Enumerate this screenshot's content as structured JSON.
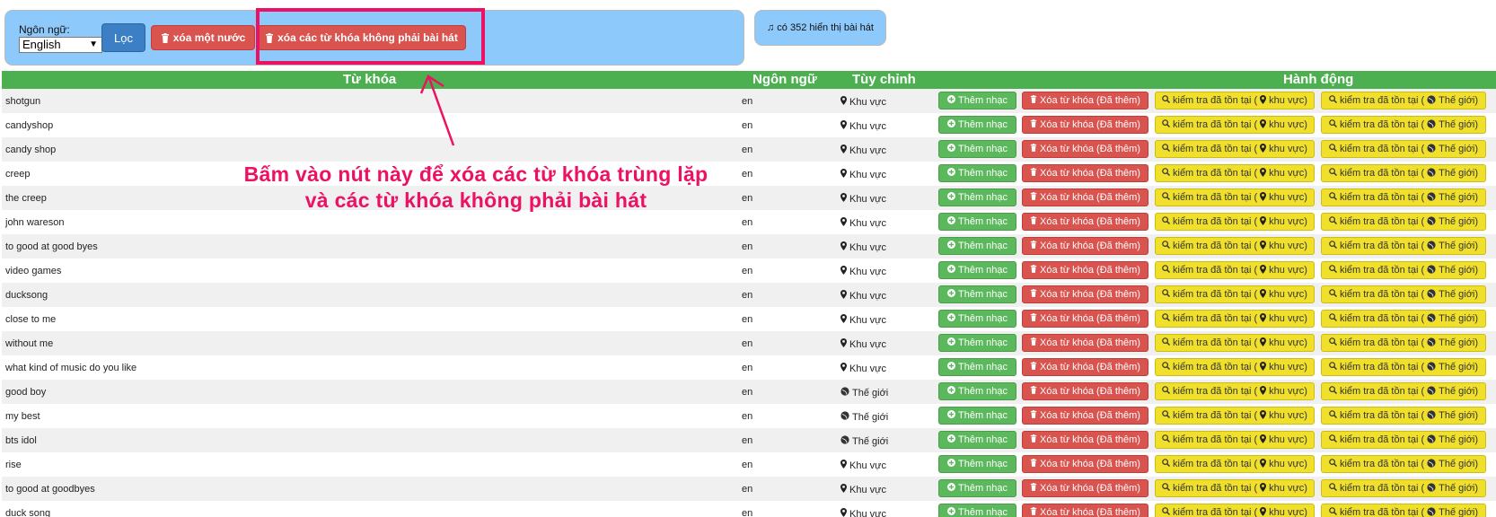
{
  "filter": {
    "language_label": "Ngôn ngữ:",
    "language_value": "English",
    "filter_button": "Lọc",
    "delete_one_button": "xóa một nước",
    "delete_non_song_button": "xóa các từ khóa không phải bài hát"
  },
  "count_badge": "có 352 hiển thị bài hát",
  "headers": {
    "keyword": "Từ khóa",
    "language": "Ngôn ngữ",
    "custom": "Tùy chỉnh",
    "actions": "Hành động"
  },
  "actions": {
    "add_music": "Thêm nhạc",
    "delete_keyword": "Xóa từ khóa (Đã thêm)",
    "check_region": "kiểm tra đã tồn tại (",
    "check_region_tail": "khu vực)",
    "check_world": "kiểm tra đã tồn tại (",
    "check_world_tail": "Thế giới)"
  },
  "rows": [
    {
      "keyword": "shotgun",
      "lang": "en",
      "scope": "Khu vực",
      "scope_icon": "map-marker-icon"
    },
    {
      "keyword": "candyshop",
      "lang": "en",
      "scope": "Khu vực",
      "scope_icon": "map-marker-icon"
    },
    {
      "keyword": "candy shop",
      "lang": "en",
      "scope": "Khu vực",
      "scope_icon": "map-marker-icon"
    },
    {
      "keyword": "creep",
      "lang": "en",
      "scope": "Khu vực",
      "scope_icon": "map-marker-icon"
    },
    {
      "keyword": "the creep",
      "lang": "en",
      "scope": "Khu vực",
      "scope_icon": "map-marker-icon"
    },
    {
      "keyword": "john wareson",
      "lang": "en",
      "scope": "Khu vực",
      "scope_icon": "map-marker-icon"
    },
    {
      "keyword": "to good at good byes",
      "lang": "en",
      "scope": "Khu vực",
      "scope_icon": "map-marker-icon"
    },
    {
      "keyword": "video games",
      "lang": "en",
      "scope": "Khu vực",
      "scope_icon": "map-marker-icon"
    },
    {
      "keyword": "ducksong",
      "lang": "en",
      "scope": "Khu vực",
      "scope_icon": "map-marker-icon"
    },
    {
      "keyword": "close to me",
      "lang": "en",
      "scope": "Khu vực",
      "scope_icon": "map-marker-icon"
    },
    {
      "keyword": "without me",
      "lang": "en",
      "scope": "Khu vực",
      "scope_icon": "map-marker-icon"
    },
    {
      "keyword": "what kind of music do you like",
      "lang": "en",
      "scope": "Khu vực",
      "scope_icon": "map-marker-icon"
    },
    {
      "keyword": "good boy",
      "lang": "en",
      "scope": "Thế giới",
      "scope_icon": "globe-icon"
    },
    {
      "keyword": "my best",
      "lang": "en",
      "scope": "Thế giới",
      "scope_icon": "globe-icon"
    },
    {
      "keyword": "bts idol",
      "lang": "en",
      "scope": "Thế giới",
      "scope_icon": "globe-icon"
    },
    {
      "keyword": "rise",
      "lang": "en",
      "scope": "Khu vực",
      "scope_icon": "map-marker-icon"
    },
    {
      "keyword": "to good at goodbyes",
      "lang": "en",
      "scope": "Khu vực",
      "scope_icon": "map-marker-icon"
    },
    {
      "keyword": "duck song",
      "lang": "en",
      "scope": "Khu vực",
      "scope_icon": "map-marker-icon"
    }
  ],
  "annotation": {
    "line1": "Bấm vào nút này để xóa các từ khóa trùng lặp",
    "line2": "và các từ khóa không phải bài hát"
  },
  "colors": {
    "panel": "#8ec9fb",
    "header_green": "#4caf50",
    "annotation": "#ec1162",
    "danger": "#d9534f",
    "success": "#5cb85c",
    "warning": "#f0e02c",
    "primary": "#3c7fc4"
  }
}
